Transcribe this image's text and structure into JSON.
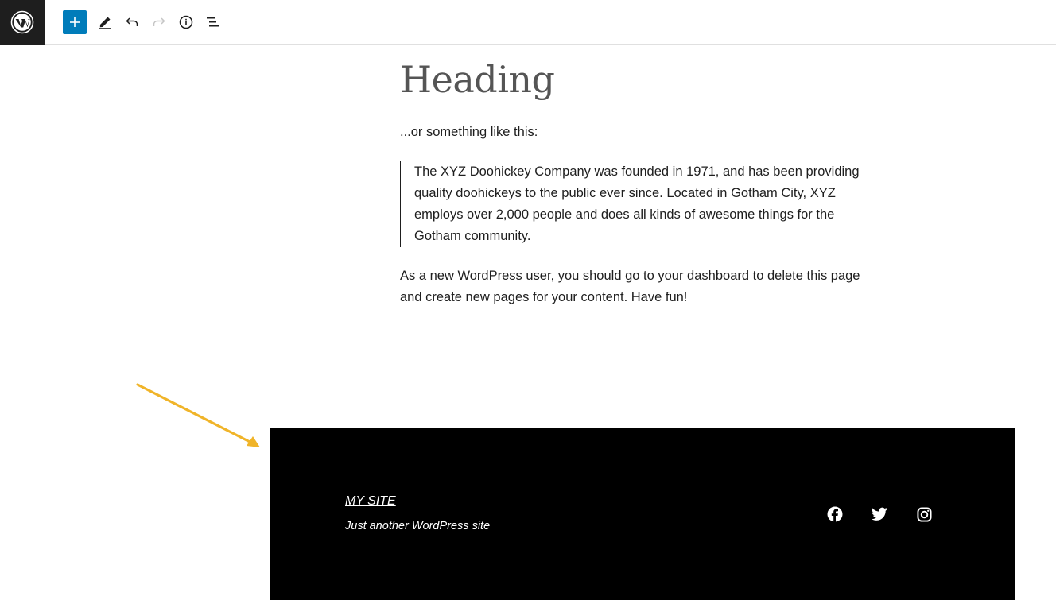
{
  "toolbar": {
    "logo_icon": "wordpress-logo-icon",
    "buttons": [
      {
        "icon": "plus-icon",
        "name": "add-block"
      },
      {
        "icon": "pencil-icon",
        "name": "tools"
      },
      {
        "icon": "undo-icon",
        "name": "undo"
      },
      {
        "icon": "redo-icon",
        "name": "redo"
      },
      {
        "icon": "info-icon",
        "name": "details"
      },
      {
        "icon": "list-view-icon",
        "name": "list-view"
      }
    ],
    "accent_color": "#007cba"
  },
  "content": {
    "heading": "Heading",
    "intro": "...or something like this:",
    "quote": "The XYZ Doohickey Company was founded in 1971, and has been providing quality doohickeys to the public ever since. Located in Gotham City, XYZ employs over 2,000 people and does all kinds of awesome things for the Gotham community.",
    "outro_before": "As a new WordPress user, you should go to ",
    "outro_link": "your dashboard",
    "outro_after": " to delete this page and create new pages for your content. Have fun!"
  },
  "annotation": {
    "arrow_color": "#f0b429"
  },
  "footer": {
    "site_title": "MY SITE",
    "tagline": "Just another WordPress site",
    "social": [
      "facebook-icon",
      "twitter-icon",
      "instagram-icon"
    ],
    "background": "#000000"
  }
}
